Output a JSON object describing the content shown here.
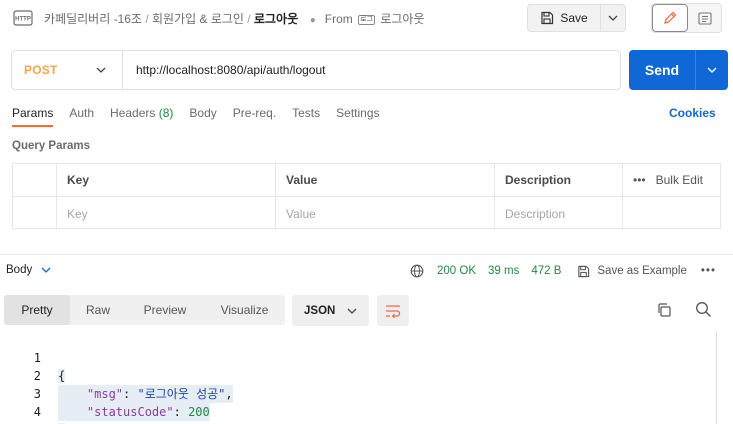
{
  "header": {
    "breadcrumb": [
      "카페딜리버리 -16조",
      "회원가입 & 로그인"
    ],
    "current": "로그아웃",
    "from_label": "From",
    "from_tag": "로그",
    "from_name": "로그아웃",
    "save_label": "Save"
  },
  "request": {
    "method": "POST",
    "method_color": "#f2a64b",
    "url": "http://localhost:8080/api/auth/logout",
    "send_label": "Send",
    "send_color": "#0f68d6"
  },
  "tabs": {
    "items": [
      "Params",
      "Auth",
      "Headers",
      "Body",
      "Pre-req.",
      "Tests",
      "Settings"
    ],
    "headers_count": "(8)",
    "active": "Params",
    "cookies": "Cookies"
  },
  "query_params": {
    "title": "Query Params",
    "columns": [
      "Key",
      "Value",
      "Description"
    ],
    "bulk_edit": "Bulk Edit",
    "placeholders": [
      "Key",
      "Value",
      "Description"
    ]
  },
  "response": {
    "body_label": "Body",
    "status": "200 OK",
    "time": "39 ms",
    "size": "472 B",
    "save_example": "Save as Example",
    "view_tabs": [
      "Pretty",
      "Raw",
      "Preview",
      "Visualize"
    ],
    "active_view": "Pretty",
    "format": "JSON",
    "lines": [
      {
        "n": "1",
        "text": "{"
      },
      {
        "n": "2",
        "key": "\"msg\"",
        "sep": ": ",
        "value": "\"로그아웃 성공\"",
        "end": ","
      },
      {
        "n": "3",
        "key": "\"statusCode\"",
        "sep": ": ",
        "value": "200",
        "end": ""
      },
      {
        "n": "4",
        "text": "}"
      }
    ]
  }
}
